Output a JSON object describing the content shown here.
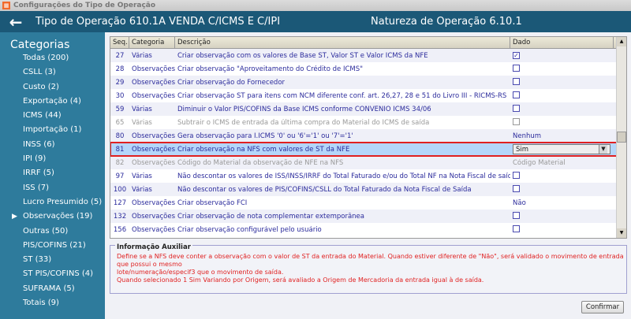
{
  "window": {
    "title": "Configurações do Tipo de Operação"
  },
  "header": {
    "title": "Tipo de Operação 610.1A  VENDA C/ICMS E C/IPI",
    "natureza": "Natureza de Operação 6.10.1"
  },
  "sidebar": {
    "title": "Categorias",
    "items": [
      {
        "label": "Todas (200)"
      },
      {
        "label": "CSLL (3)"
      },
      {
        "label": "Custo (2)"
      },
      {
        "label": "Exportação (4)"
      },
      {
        "label": "ICMS (44)"
      },
      {
        "label": "Importação (1)"
      },
      {
        "label": "INSS (6)"
      },
      {
        "label": "IPI (9)"
      },
      {
        "label": "IRRF (5)"
      },
      {
        "label": "ISS (7)"
      },
      {
        "label": "Lucro Presumido (5)"
      },
      {
        "label": "Observações (19)",
        "selected": true
      },
      {
        "label": "Outras (50)"
      },
      {
        "label": "PIS/COFINS (21)"
      },
      {
        "label": "ST (33)"
      },
      {
        "label": "ST PIS/COFINS (4)"
      },
      {
        "label": "SUFRAMA (5)"
      },
      {
        "label": "Totais (9)"
      }
    ]
  },
  "grid": {
    "columns": [
      "Seq.",
      "Categoria",
      "Descrição",
      "Dado"
    ],
    "rows": [
      {
        "seq": "27",
        "cat": "Várias",
        "desc": "Criar observação com os valores de Base ST, Valor ST e Valor ICMS da NFE",
        "type": "check",
        "checked": true
      },
      {
        "seq": "28",
        "cat": "Observações",
        "desc": "Criar observação \"Aproveitamento do Crédito de ICMS\"",
        "type": "check",
        "checked": false
      },
      {
        "seq": "29",
        "cat": "Observações",
        "desc": "Criar observação do Fornecedor",
        "type": "check",
        "checked": false
      },
      {
        "seq": "30",
        "cat": "Observações",
        "desc": "Criar observação ST para itens com NCM diferente conf. art. 26,27, 28 e 51 do Livro III - RICMS-RS",
        "type": "check",
        "checked": false
      },
      {
        "seq": "59",
        "cat": "Várias",
        "desc": "Diminuir o Valor PIS/COFINS da Base ICMS conforme CONVÊNIO ICMS 34/06",
        "type": "check",
        "checked": false
      },
      {
        "seq": "65",
        "cat": "Várias",
        "desc": "Subtrair o ICMS de entrada da última compra do Material do ICMS de saída",
        "type": "check",
        "checked": false,
        "disabled": true
      },
      {
        "seq": "80",
        "cat": "Observações",
        "desc": "Gera observação para I.ICMS '0' ou '6'='1' ou '7'='1'",
        "type": "text",
        "value": "Nenhum"
      },
      {
        "seq": "81",
        "cat": "Observações",
        "desc": "Criar observação na NFS com valores de ST da NFE",
        "type": "combo",
        "value": "Sim",
        "selected": true
      },
      {
        "seq": "82",
        "cat": "Observações",
        "desc": "Código do Material da observação de NFE na NFS",
        "type": "text",
        "value": "Código Material",
        "disabled": true
      },
      {
        "seq": "97",
        "cat": "Várias",
        "desc": "Não descontar os valores de ISS/INSS/IRRF do Total Faturado e/ou do Total NF na Nota Fiscal de saída",
        "type": "check",
        "checked": false
      },
      {
        "seq": "100",
        "cat": "Várias",
        "desc": "Não descontar os valores de PIS/COFINS/CSLL do Total Faturado da Nota Fiscal de Saída",
        "type": "check",
        "checked": false
      },
      {
        "seq": "127",
        "cat": "Observações",
        "desc": "Criar observação FCI",
        "type": "text",
        "value": "Não"
      },
      {
        "seq": "132",
        "cat": "Observações",
        "desc": "Criar observação de nota complementar extemporânea",
        "type": "check",
        "checked": false
      },
      {
        "seq": "156",
        "cat": "Observações",
        "desc": "Criar observação configurável pelo usuário",
        "type": "check",
        "checked": false
      }
    ]
  },
  "info": {
    "title": "Informação Auxiliar",
    "lines": [
      "Define se a NFS deve conter a observação com o valor de ST da entrada do Material. Quando estiver diferente de \"Não\", será validado o movimento de entrada que possui o mesmo",
      "lote/numeração/especif3 que o movimento de saída.",
      "Quando selecionado 1 Sim Variando por Origem, será avaliado a Origem de Mercadoria da entrada igual à de saída."
    ]
  },
  "buttons": {
    "confirm": "Confirmar"
  }
}
